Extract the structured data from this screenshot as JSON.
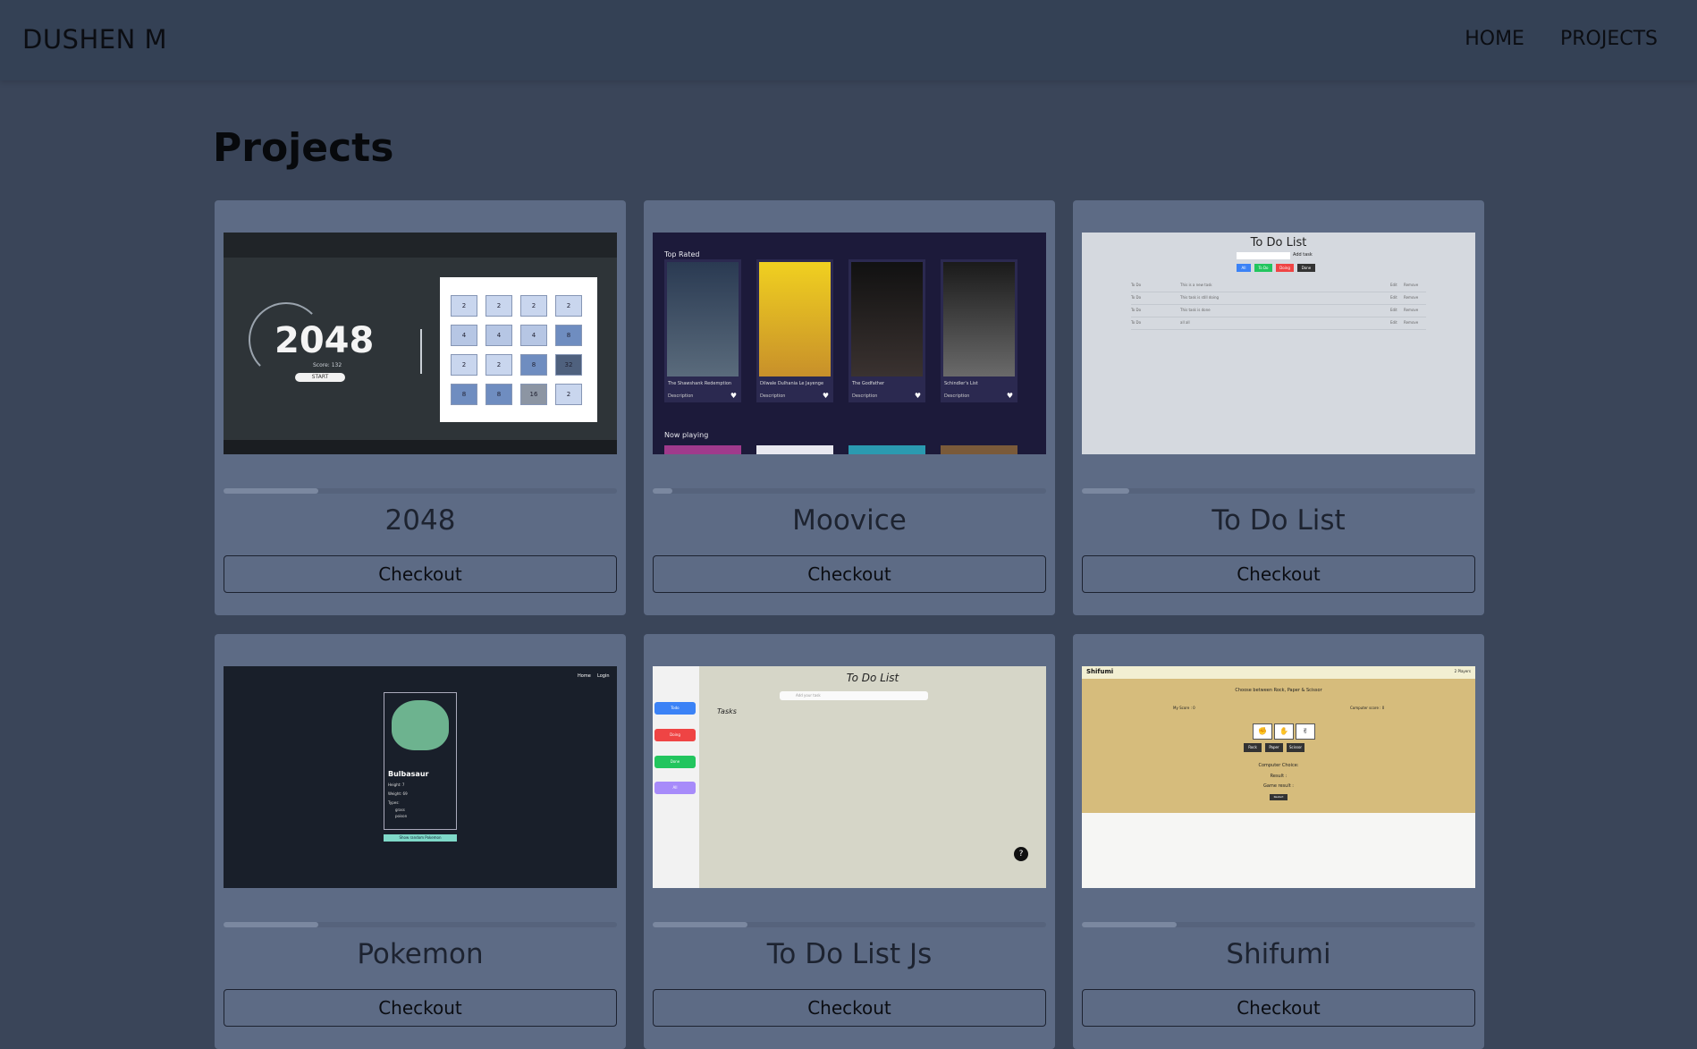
{
  "nav": {
    "brand": "DUSHEN M",
    "links": [
      "HOME",
      "PROJECTS"
    ]
  },
  "page": {
    "title": "Projects"
  },
  "cards": [
    {
      "title": "2048",
      "button": "Checkout",
      "progress": 0.24
    },
    {
      "title": "Moovice",
      "button": "Checkout",
      "progress": 0.05
    },
    {
      "title": "To Do List",
      "button": "Checkout",
      "progress": 0.12
    },
    {
      "title": "Pokemon",
      "button": "Checkout",
      "progress": 0.24
    },
    {
      "title": "To Do List Js",
      "button": "Checkout",
      "progress": 0.24
    },
    {
      "title": "Shifumi",
      "button": "Checkout",
      "progress": 0.24
    }
  ],
  "thumbs": {
    "g2048": {
      "big": "2048",
      "score": "Score: 132",
      "start": "START",
      "tiles": [
        "2",
        "2",
        "2",
        "2",
        "4",
        "4",
        "4",
        "8",
        "2",
        "2",
        "8",
        "32",
        "8",
        "8",
        "16",
        "2"
      ]
    },
    "moovice": {
      "top_rated": "Top Rated",
      "now_playing": "Now playing",
      "films": [
        "The Shawshank Redemption",
        "Dilwale Dulhania Le Jayenge",
        "The Godfather",
        "Schindler's List"
      ],
      "desc": "Description"
    },
    "todo": {
      "title": "To Do List",
      "add": "Add task",
      "filters": [
        "All",
        "To Do",
        "Doing",
        "Done"
      ],
      "rows": [
        "This is a new task",
        "This task is still doing",
        "This task is done",
        "all all"
      ],
      "tag": "To Do",
      "edit": "Edit",
      "remove": "Remove"
    },
    "pokemon": {
      "nav": [
        "Home",
        "Login"
      ],
      "name": "Bulbasaur",
      "height": "Height: 7",
      "weight": "Weight: 69",
      "types_label": "Types:",
      "types": [
        "grass",
        "poison"
      ],
      "button": "Show random Pokemon"
    },
    "todojs": {
      "title": "To Do List",
      "placeholder": "Add your task",
      "tasks": "Tasks",
      "side": [
        "Todo",
        "Doing",
        "Done",
        "All"
      ],
      "help": "?"
    },
    "shifumi": {
      "title": "Shifumi",
      "players": "2 Players",
      "prompt": "Choose between Rock, Paper & Scissor",
      "my_score": "My Score : 0",
      "comp_score": "Computer score : 0",
      "choices": [
        "Rock",
        "Paper",
        "Scissor"
      ],
      "computer_choice": "Computer Choice:",
      "result": "Result :",
      "game_result": "Game result :",
      "restart": "Restart"
    }
  }
}
